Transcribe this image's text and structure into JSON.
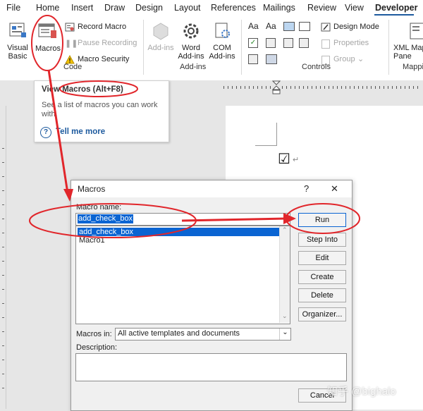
{
  "menubar": {
    "tabs": [
      "File",
      "Home",
      "Insert",
      "Draw",
      "Design",
      "Layout",
      "References",
      "Mailings",
      "Review",
      "View",
      "Developer"
    ],
    "active": "Developer"
  },
  "ribbon": {
    "code": {
      "visual_basic": "Visual Basic",
      "macros": "Macros",
      "record_macro": "Record Macro",
      "pause_recording": "Pause Recording",
      "macro_security": "Macro Security",
      "group_label": "Code"
    },
    "addins": {
      "addins": "Add-ins",
      "word_addins": "Word Add-ins",
      "com_addins": "COM Add-ins",
      "group_label": "Add-ins"
    },
    "controls": {
      "design_mode": "Design Mode",
      "properties": "Properties",
      "group": "Group",
      "group_label": "Controls"
    },
    "mapping": {
      "xml_mapping": "XML Mapping Pane",
      "group_label": "Mapping"
    }
  },
  "tooltip": {
    "title": "View Macros (Alt+F8)",
    "description": "See a list of macros you can work with.",
    "tell_me_more": "Tell me more"
  },
  "document": {
    "checkbox_glyph": "☑",
    "paragraph_mark": "↵"
  },
  "dialog": {
    "title": "Macros",
    "help": "?",
    "close": "✕",
    "macro_name_label": "Macro name:",
    "macro_name_value": "add_check_box",
    "macros": [
      "add_check_box",
      "Macro1"
    ],
    "selected_macro": "add_check_box",
    "buttons": {
      "run": "Run",
      "step_into": "Step Into",
      "edit": "Edit",
      "create": "Create",
      "delete": "Delete",
      "organizer": "Organizer...",
      "cancel": "Cancel"
    },
    "macros_in_label": "Macros in:",
    "macros_in_value": "All active templates and documents",
    "description_label": "Description:"
  },
  "watermark": "知乎 @bighalo",
  "colors": {
    "annotation_red": "#e1262b",
    "selection_blue": "#0a64d2",
    "accent_blue": "#1d5a9e"
  }
}
